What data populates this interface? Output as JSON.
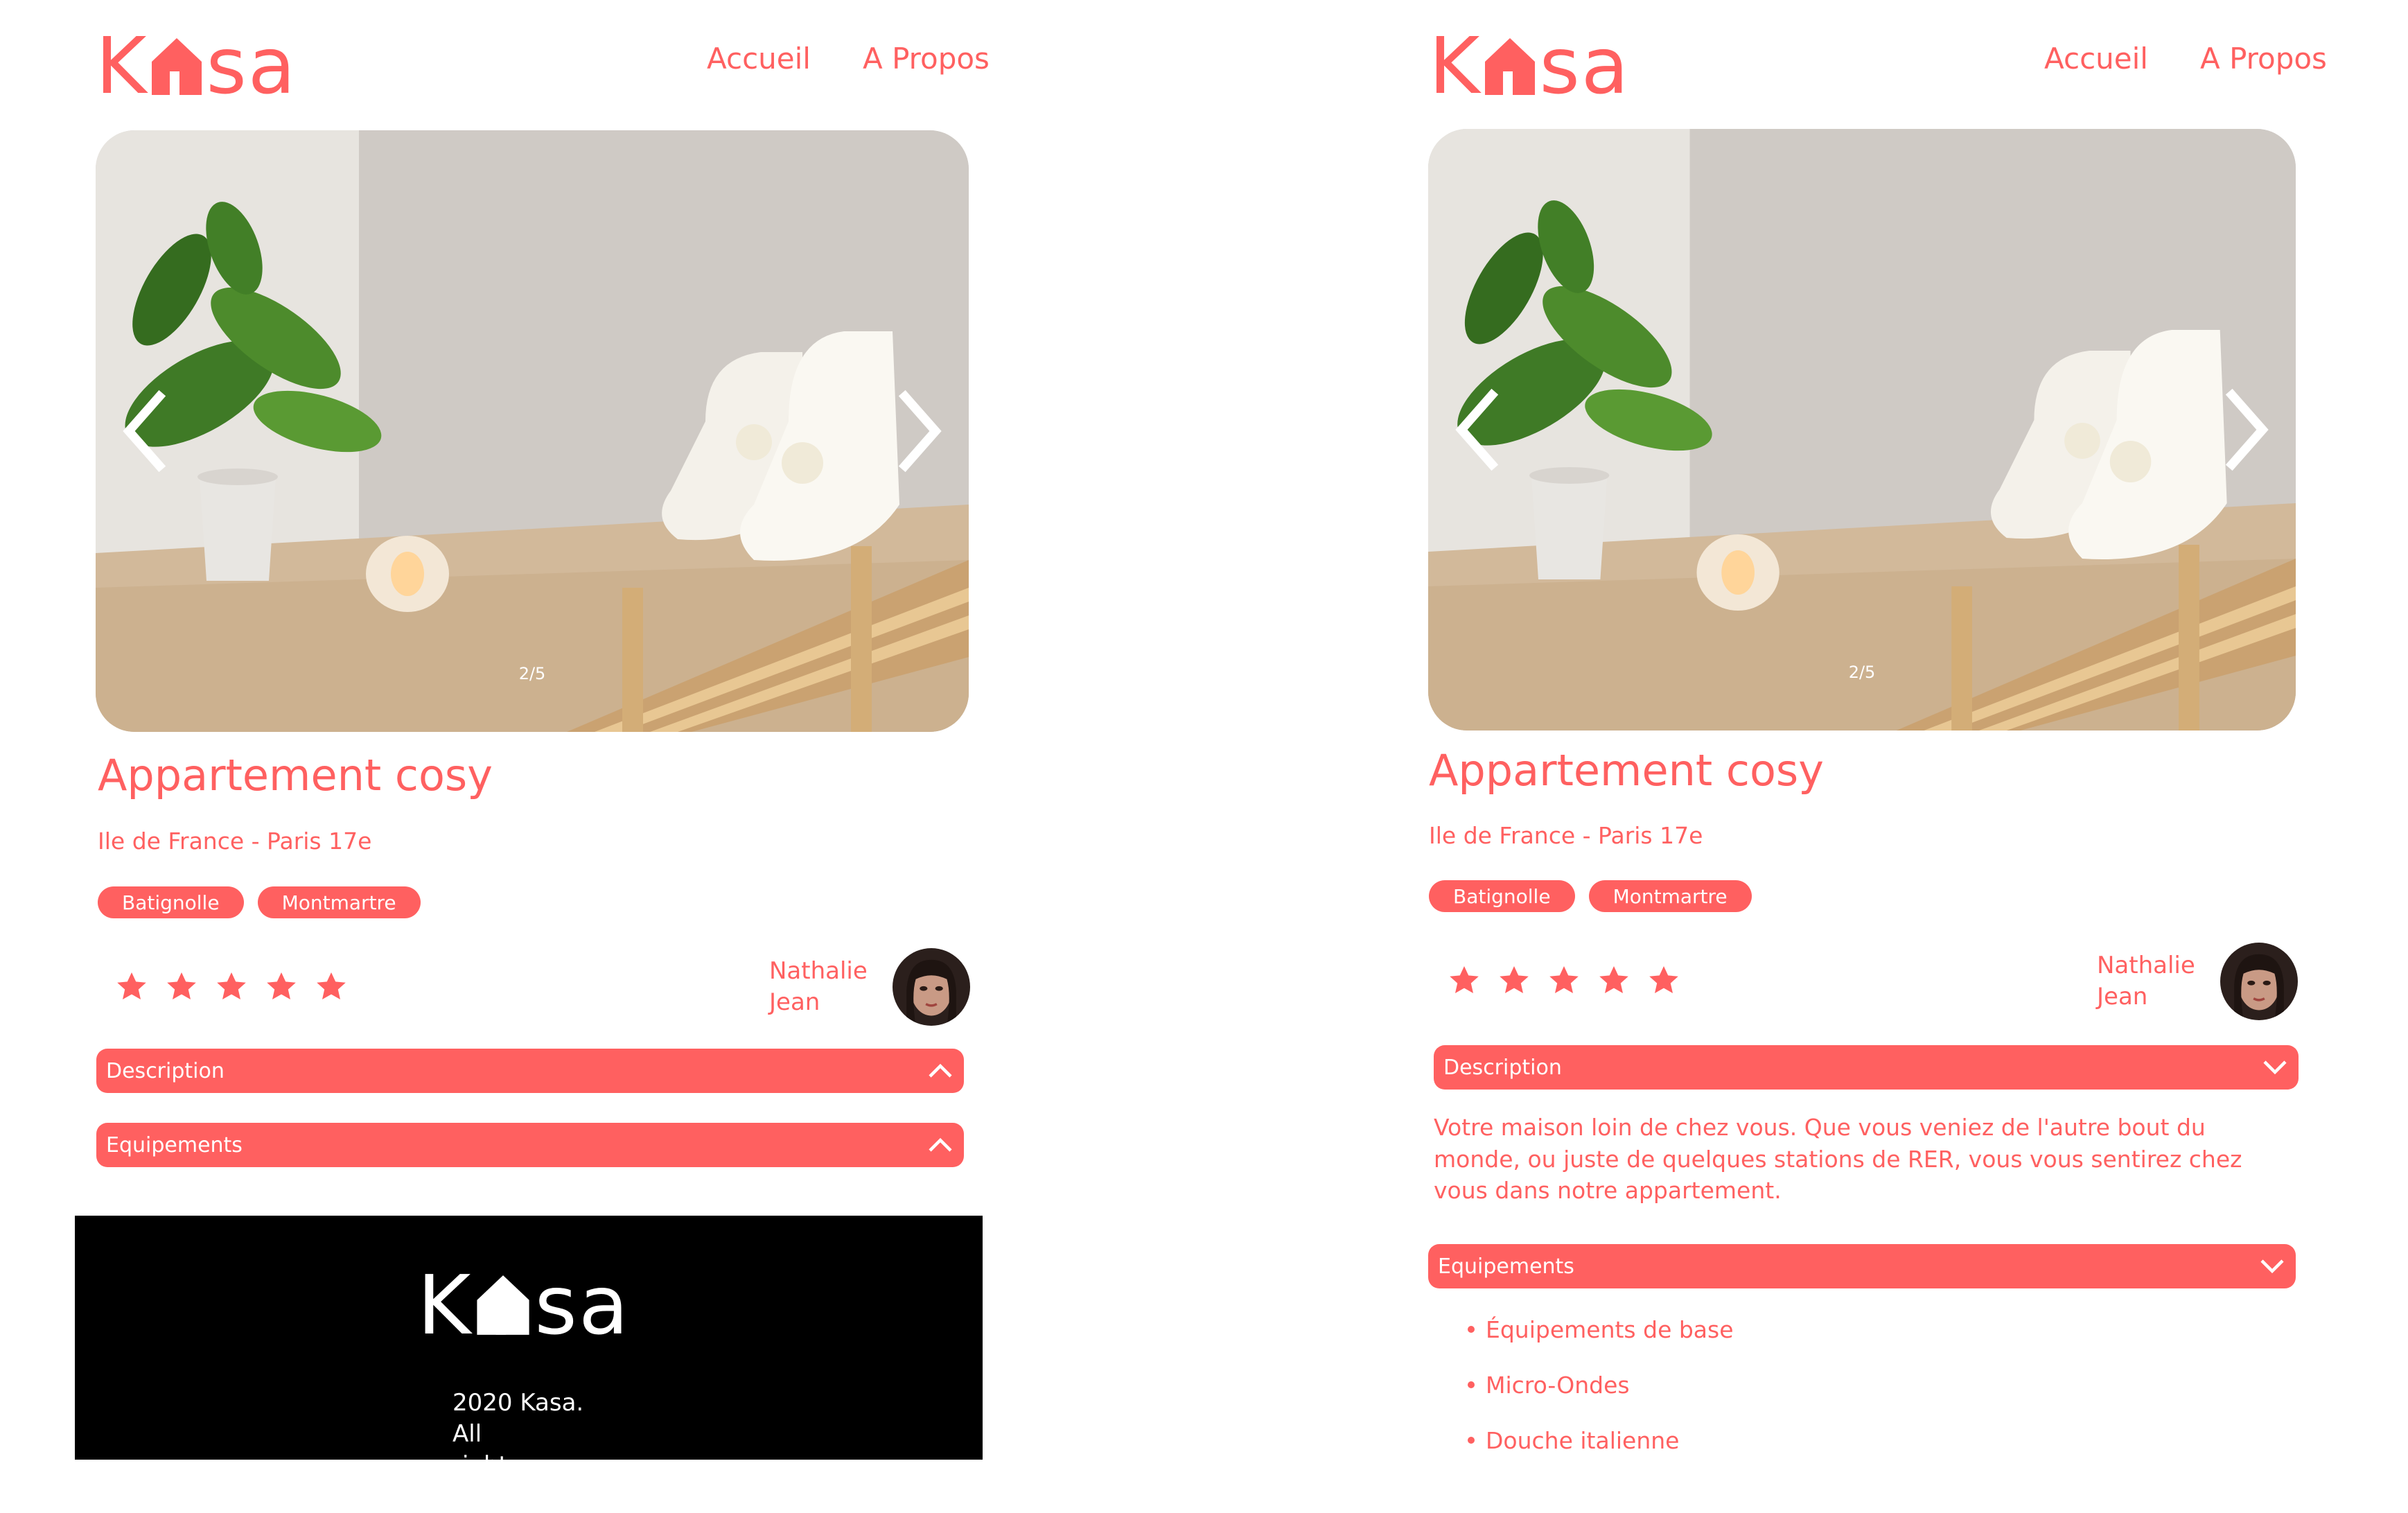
{
  "logo": {
    "k": "K",
    "sa": "sa",
    "house_icon": "house-icon"
  },
  "nav": {
    "home": "Accueil",
    "about": "A Propos"
  },
  "carousel": {
    "counter": "2/5",
    "prev_icon": "chevron-left-icon",
    "next_icon": "chevron-right-icon"
  },
  "listing": {
    "title": "Appartement cosy",
    "location": "Ile de France - Paris 17e",
    "tags": [
      "Batignolle",
      "Montmartre"
    ],
    "rating": 5,
    "rating_max": 5,
    "host": {
      "first": "Nathalie",
      "last": "Jean"
    }
  },
  "collapses": {
    "description_label": "Description",
    "equipments_label": "Equipements",
    "description_text": "Votre maison loin de chez vous. Que vous veniez de l'autre bout du monde, ou juste de quelques stations de RER, vous vous sentirez chez vous dans notre appartement.",
    "equipments": [
      "Équipements de base",
      "Micro-Ondes",
      "Douche italienne"
    ]
  },
  "footer": {
    "text_line1": "2020 Kasa. All",
    "text_line2": "rights reserved"
  },
  "colors": {
    "accent": "#FF6060",
    "footer_bg": "#000000",
    "text_on_accent": "#FFFFFF"
  }
}
